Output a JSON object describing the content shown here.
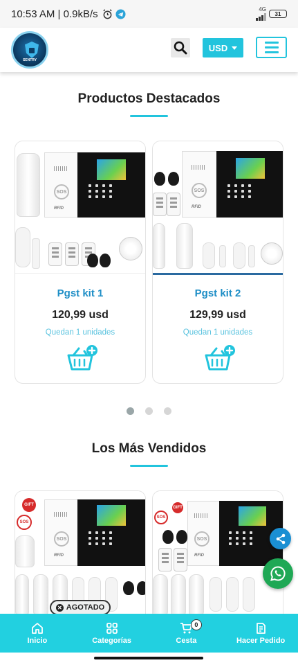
{
  "status_bar": {
    "time": "10:53 AM | 0.9kB/s",
    "network": "4G",
    "battery": "31"
  },
  "header": {
    "logo_text": "SENTRY",
    "currency": "USD"
  },
  "featured": {
    "title": "Productos Destacados",
    "products": [
      {
        "name": "Pgst kit 1",
        "price": "120,99 usd",
        "stock": "Quedan 1 unidades"
      },
      {
        "name": "Pgst kit 2",
        "price": "129,99 usd",
        "stock": "Quedan 1 unidades"
      }
    ],
    "carousel_pages": 3,
    "active_page": 1
  },
  "best_sellers": {
    "title": "Los Más Vendidos",
    "badge": "AGOTADO"
  },
  "product_image_text": {
    "sos": "SOS",
    "rfid": "RFID",
    "gift": "GIFT"
  },
  "bottom_nav": {
    "items": [
      {
        "label": "Inicio",
        "icon": "home-icon"
      },
      {
        "label": "Categorías",
        "icon": "grid-icon"
      },
      {
        "label": "Cesta",
        "icon": "cart-icon"
      },
      {
        "label": "Hacer Pedido",
        "icon": "order-icon"
      }
    ],
    "cart_count": "0"
  },
  "colors": {
    "accent": "#22c4dd",
    "nav_bg": "#22d0e0",
    "product_name": "#1e8ec6",
    "whatsapp": "#1fa855",
    "share": "#1a8fd3"
  }
}
